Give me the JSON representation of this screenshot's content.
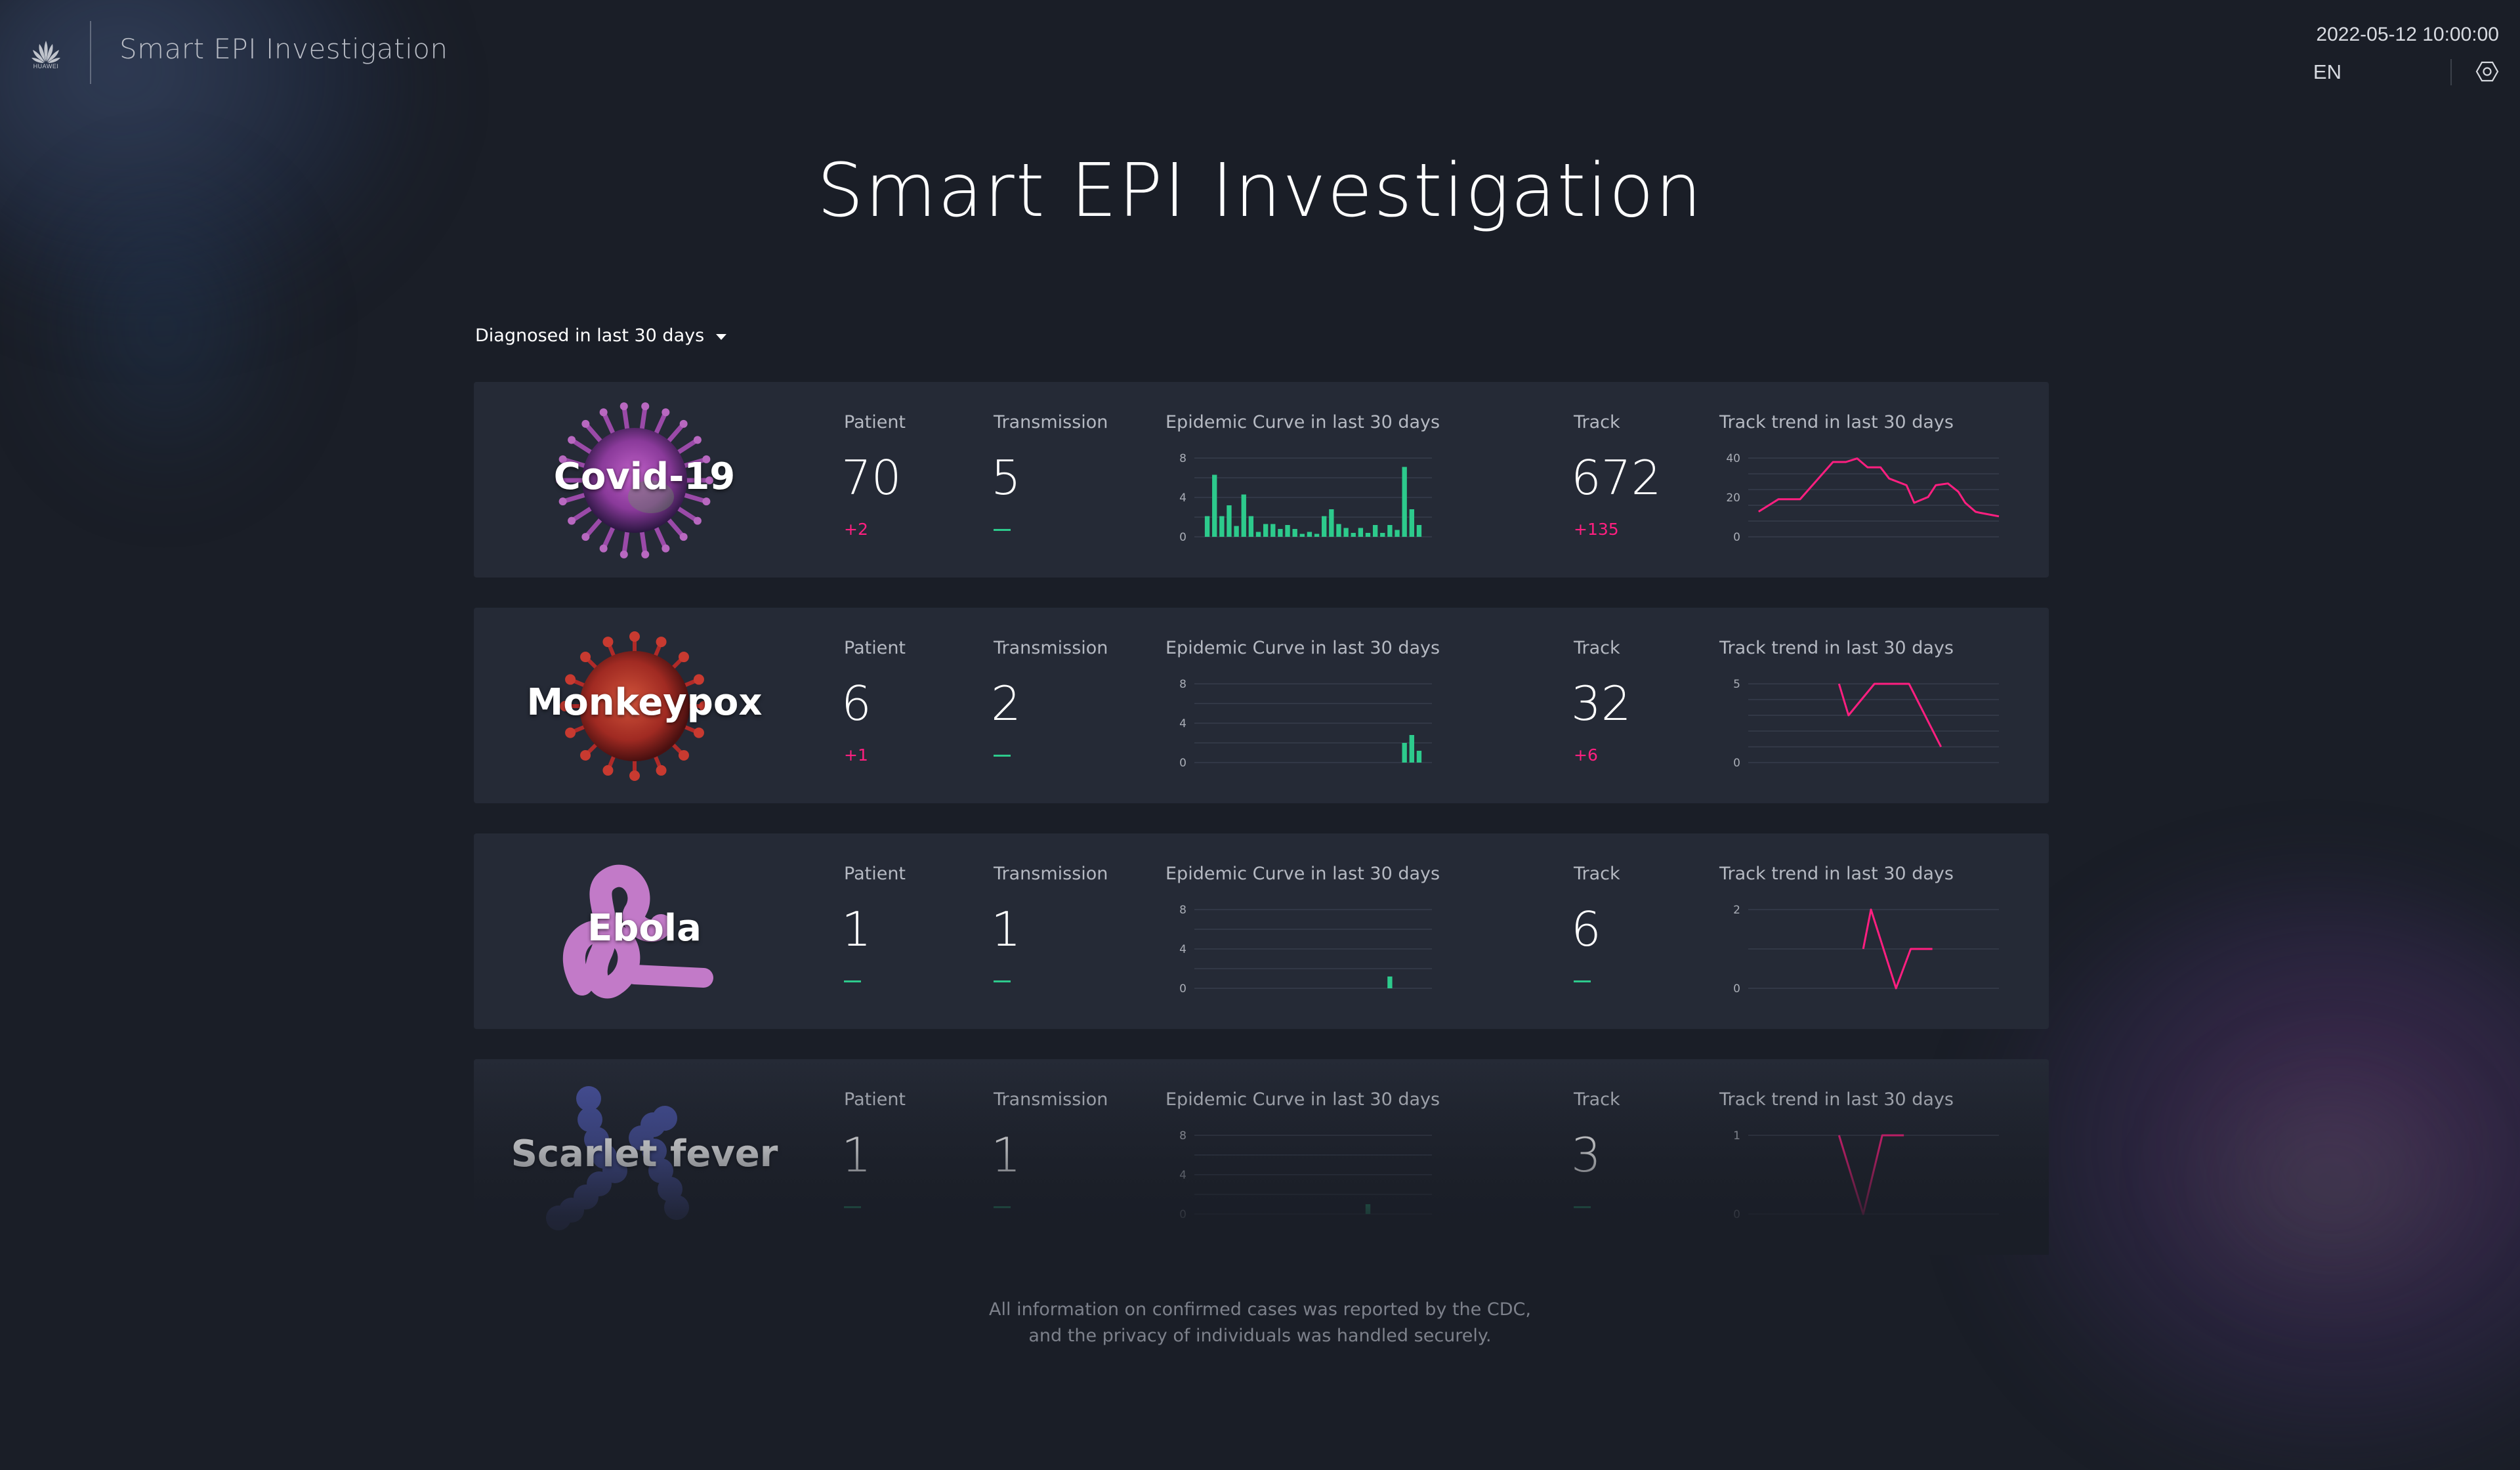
{
  "header": {
    "brand": "HUAWEI",
    "app_title": "Smart EPI Investigation",
    "datetime": "2022-05-12 10:00:00",
    "language": "EN",
    "icons": {
      "logo": "huawei-logo-icon",
      "settings": "settings-icon"
    }
  },
  "page_title": "Smart EPI Investigation",
  "filter": {
    "selected": "Diagnosed in last 30 days",
    "icon": "caret-down-icon"
  },
  "labels": {
    "patient": "Patient",
    "transmission": "Transmission",
    "epidemic_curve": "Epidemic Curve in last 30 days",
    "track": "Track",
    "track_trend": "Track trend in last 30 days"
  },
  "colors": {
    "increase": "#ff1f80",
    "no_change": "#2dca8c",
    "bar": "#2dca8c",
    "trend_line": "#ff1f80"
  },
  "diseases": [
    {
      "name": "Covid-19",
      "image_icon": "covid-virus-image",
      "patient": "70",
      "patient_delta": "+2",
      "transmission": "5",
      "transmission_delta": "",
      "track": "672",
      "track_delta": "+135"
    },
    {
      "name": "Monkeypox",
      "image_icon": "monkeypox-virus-image",
      "patient": "6",
      "patient_delta": "+1",
      "transmission": "2",
      "transmission_delta": "",
      "track": "32",
      "track_delta": "+6"
    },
    {
      "name": "Ebola",
      "image_icon": "ebola-virus-image",
      "patient": "1",
      "patient_delta": "",
      "transmission": "1",
      "transmission_delta": "",
      "track": "6",
      "track_delta": ""
    },
    {
      "name": "Scarlet fever",
      "image_icon": "scarlet-fever-bacteria-image",
      "patient": "1",
      "patient_delta": "",
      "transmission": "1",
      "transmission_delta": "",
      "track": "3",
      "track_delta": ""
    }
  ],
  "chart_data": [
    {
      "type": "bar",
      "title": "Epidemic Curve in last 30 days",
      "disease": "Covid-19",
      "ylim": [
        0,
        8
      ],
      "yticks": [
        "8",
        "4",
        "0"
      ],
      "grid": true,
      "days": 30,
      "values": [
        2.1,
        6.3,
        2.1,
        3.2,
        1.1,
        4.3,
        2.1,
        0.5,
        1.3,
        1.3,
        0.8,
        1.2,
        0.8,
        0.3,
        0.5,
        0.3,
        2.1,
        2.8,
        1.3,
        0.9,
        0.4,
        0.9,
        0.4,
        1.2,
        0.4,
        1.2,
        0.7,
        7.1,
        2.8,
        1.2
      ]
    },
    {
      "type": "line",
      "title": "Track trend in last 30 days",
      "disease": "Covid-19",
      "ylim": [
        0,
        40
      ],
      "yticks": [
        "40",
        "20",
        "0"
      ],
      "grid": true,
      "days": 30,
      "points": [
        [
          1.2,
          12.8
        ],
        [
          3.5,
          19.1
        ],
        [
          6,
          19.1
        ],
        [
          9.8,
          38
        ],
        [
          11.3,
          38
        ],
        [
          12.6,
          39.8
        ],
        [
          13.8,
          35.3
        ],
        [
          15.3,
          35.3
        ],
        [
          16.3,
          29.6
        ],
        [
          18.3,
          26.2
        ],
        [
          19.2,
          17.3
        ],
        [
          20.8,
          20.2
        ],
        [
          21.7,
          26.2
        ],
        [
          23.1,
          27.1
        ],
        [
          24.3,
          22.9
        ],
        [
          25.1,
          17.3
        ],
        [
          26.3,
          12.7
        ],
        [
          26.8,
          12.2
        ],
        [
          29,
          10.4
        ]
      ]
    },
    {
      "type": "bar",
      "title": "Epidemic Curve in last 30 days",
      "disease": "Monkeypox",
      "ylim": [
        0,
        8
      ],
      "yticks": [
        "8",
        "4",
        "0"
      ],
      "grid": true,
      "days": 30,
      "values": [
        0,
        0,
        0,
        0,
        0,
        0,
        0,
        0,
        0,
        0,
        0,
        0,
        0,
        0,
        0,
        0,
        0,
        0,
        0,
        0,
        0,
        0,
        0,
        0,
        0,
        0,
        0,
        2,
        2.8,
        1.2
      ]
    },
    {
      "type": "line",
      "title": "Track trend in last 30 days",
      "disease": "Monkeypox",
      "ylim": [
        0,
        5
      ],
      "yticks": [
        "5",
        "0"
      ],
      "grid": true,
      "days": 30,
      "points": [
        [
          10.5,
          5
        ],
        [
          11.6,
          3
        ],
        [
          14.6,
          5
        ],
        [
          18.6,
          5
        ],
        [
          22.3,
          1
        ]
      ]
    },
    {
      "type": "bar",
      "title": "Epidemic Curve in last 30 days",
      "disease": "Ebola",
      "ylim": [
        0,
        8
      ],
      "yticks": [
        "8",
        "4",
        "0"
      ],
      "grid": true,
      "days": 30,
      "values": [
        0,
        0,
        0,
        0,
        0,
        0,
        0,
        0,
        0,
        0,
        0,
        0,
        0,
        0,
        0,
        0,
        0,
        0,
        0,
        0,
        0,
        0,
        0,
        0,
        0,
        1.2,
        0,
        0,
        0,
        0
      ]
    },
    {
      "type": "line",
      "title": "Track trend in last 30 days",
      "disease": "Ebola",
      "ylim": [
        0,
        2
      ],
      "yticks": [
        "2",
        "0"
      ],
      "grid": true,
      "days": 30,
      "points": [
        [
          13.3,
          1
        ],
        [
          14.2,
          2
        ],
        [
          17.1,
          0
        ],
        [
          18.8,
          1
        ],
        [
          21.3,
          1
        ]
      ]
    },
    {
      "type": "bar",
      "title": "Epidemic Curve in last 30 days",
      "disease": "Scarlet fever",
      "ylim": [
        0,
        8
      ],
      "yticks": [
        "8",
        "4",
        "0"
      ],
      "grid": true,
      "days": 30,
      "values": [
        0,
        0,
        0,
        0,
        0,
        0,
        0,
        0,
        0,
        0,
        0,
        0,
        0,
        0,
        0,
        0,
        0,
        0,
        0,
        0,
        0,
        0,
        1,
        0,
        0,
        0,
        0,
        0,
        0,
        0
      ]
    },
    {
      "type": "line",
      "title": "Track trend in last 30 days",
      "disease": "Scarlet fever",
      "ylim": [
        0,
        1
      ],
      "yticks": [
        "1",
        "0"
      ],
      "grid": true,
      "days": 30,
      "points": [
        [
          10.5,
          1
        ],
        [
          13.3,
          0
        ],
        [
          15.5,
          1
        ],
        [
          18,
          1
        ]
      ]
    }
  ],
  "footer": {
    "line1": "All information on confirmed cases was reported by the CDC,",
    "line2": "and the privacy of individuals was handled securely."
  }
}
